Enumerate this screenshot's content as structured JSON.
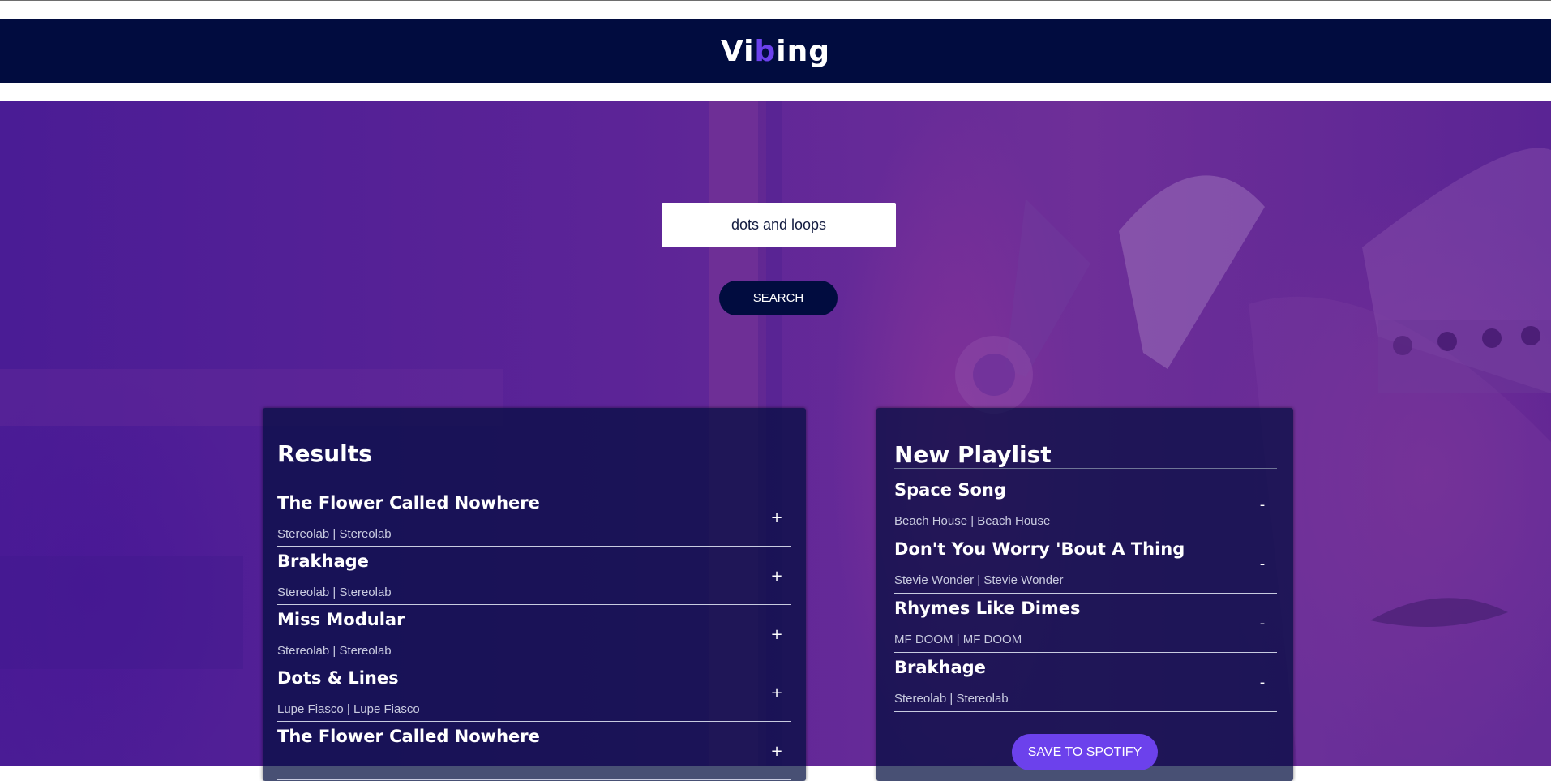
{
  "header": {
    "logo_part1": "Vi",
    "logo_accent": "b",
    "logo_part2": "ing"
  },
  "search": {
    "value": "dots and loops",
    "button_label": "SEARCH"
  },
  "results": {
    "title": "Results",
    "action_symbol": "+",
    "tracks": [
      {
        "name": "The Flower Called Nowhere",
        "info": "Stereolab | Stereolab"
      },
      {
        "name": "Brakhage",
        "info": "Stereolab | Stereolab"
      },
      {
        "name": "Miss Modular",
        "info": "Stereolab | Stereolab"
      },
      {
        "name": "Dots & Lines",
        "info": "Lupe Fiasco | Lupe Fiasco"
      },
      {
        "name": "The Flower Called Nowhere",
        "info": ""
      }
    ]
  },
  "playlist": {
    "title": "New Playlist",
    "action_symbol": "-",
    "tracks": [
      {
        "name": "Space Song",
        "info": "Beach House | Beach House"
      },
      {
        "name": "Don't You Worry 'Bout A Thing",
        "info": "Stevie Wonder | Stevie Wonder"
      },
      {
        "name": "Rhymes Like Dimes",
        "info": "MF DOOM | MF DOOM"
      },
      {
        "name": "Brakhage",
        "info": "Stereolab | Stereolab"
      }
    ],
    "save_label": "SAVE TO SPOTIFY"
  },
  "colors": {
    "header_bg": "#010c3f",
    "accent": "#6c41ec",
    "hero_purple": "#5b2594"
  }
}
